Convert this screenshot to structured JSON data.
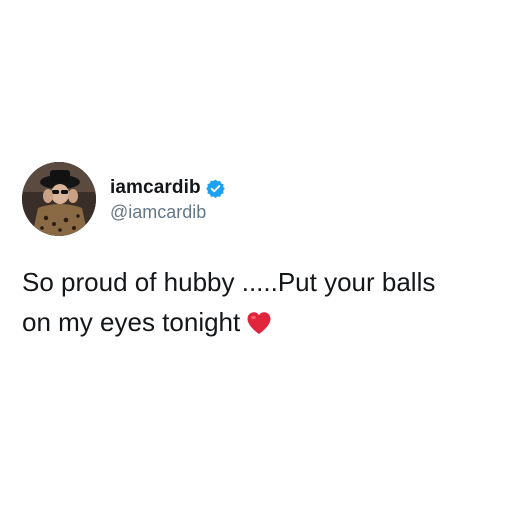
{
  "tweet": {
    "display_name": "iamcardib",
    "handle": "@iamcardib",
    "verified": true,
    "text_line1": "So proud of hubby .....Put your balls",
    "text_line2": "on my eyes tonight",
    "emoji": "red-heart-icon",
    "colors": {
      "text": "#14171a",
      "handle": "#657786",
      "verified": "#1da1f2",
      "heart": "#e0253c"
    }
  }
}
